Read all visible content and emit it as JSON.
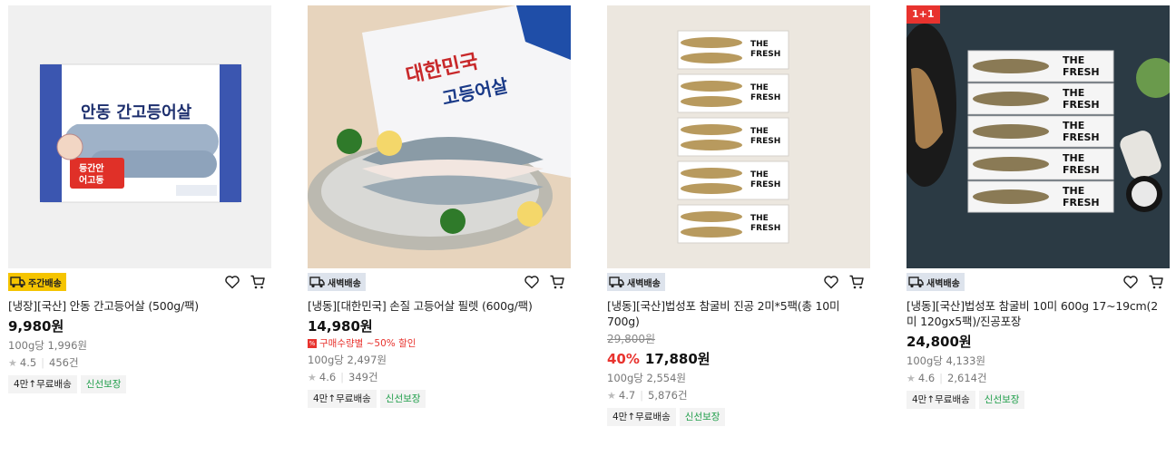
{
  "products": [
    {
      "delivery": "주간배송",
      "delivery_type": "weekly",
      "title": "[냉장][국산] 안동 간고등어살 (500g/팩)",
      "price": "9,980원",
      "unit_price": "100g당 1,996원",
      "rating": "4.5",
      "reviews": "456건",
      "tags": [
        "4만↑무료배송",
        "신선보장"
      ],
      "package_text": {
        "brand": "안동 간고등어살",
        "sticker": "등간안 어고동"
      }
    },
    {
      "delivery": "새벽배송",
      "delivery_type": "dawn",
      "title": "[냉동][대한민국] 손질 고등어살 필렛 (600g/팩)",
      "price": "14,980원",
      "promo_note": "구매수량별 ~50% 할인",
      "unit_price": "100g당 2,497원",
      "rating": "4.6",
      "reviews": "349건",
      "tags": [
        "4만↑무료배송",
        "신선보장"
      ],
      "package_text": {
        "brand": "대한민국 고등어살"
      }
    },
    {
      "delivery": "새벽배송",
      "delivery_type": "dawn",
      "title": "[냉동][국산]법성포 참굴비 진공 2미*5팩(총 10미 700g)",
      "original_price": "29,800원",
      "discount": "40%",
      "price": "17,880원",
      "unit_price": "100g당 2,554원",
      "rating": "4.7",
      "reviews": "5,876건",
      "tags": [
        "4만↑무료배송",
        "신선보장"
      ],
      "package_text": {
        "brand": "THE FRESH"
      }
    },
    {
      "badge": "1+1",
      "delivery": "새벽배송",
      "delivery_type": "dawn",
      "title": "[냉동][국산]법성포 참굴비 10미 600g 17~19cm(2미 120gx5팩)/진공포장",
      "price": "24,800원",
      "unit_price": "100g당 4,133원",
      "rating": "4.6",
      "reviews": "2,614건",
      "tags": [
        "4만↑무료배송",
        "신선보장"
      ],
      "package_text": {
        "brand": "THE FRESH"
      }
    }
  ],
  "icons": {
    "wish": "heart-icon",
    "cart": "cart-icon",
    "delivery": "truck-icon",
    "star": "star-icon"
  },
  "colors": {
    "accent_red": "#e8332e",
    "weekly_yellow": "#f5c400",
    "dawn_blue": "#dde3ec",
    "fresh_green": "#1f9e4a"
  }
}
